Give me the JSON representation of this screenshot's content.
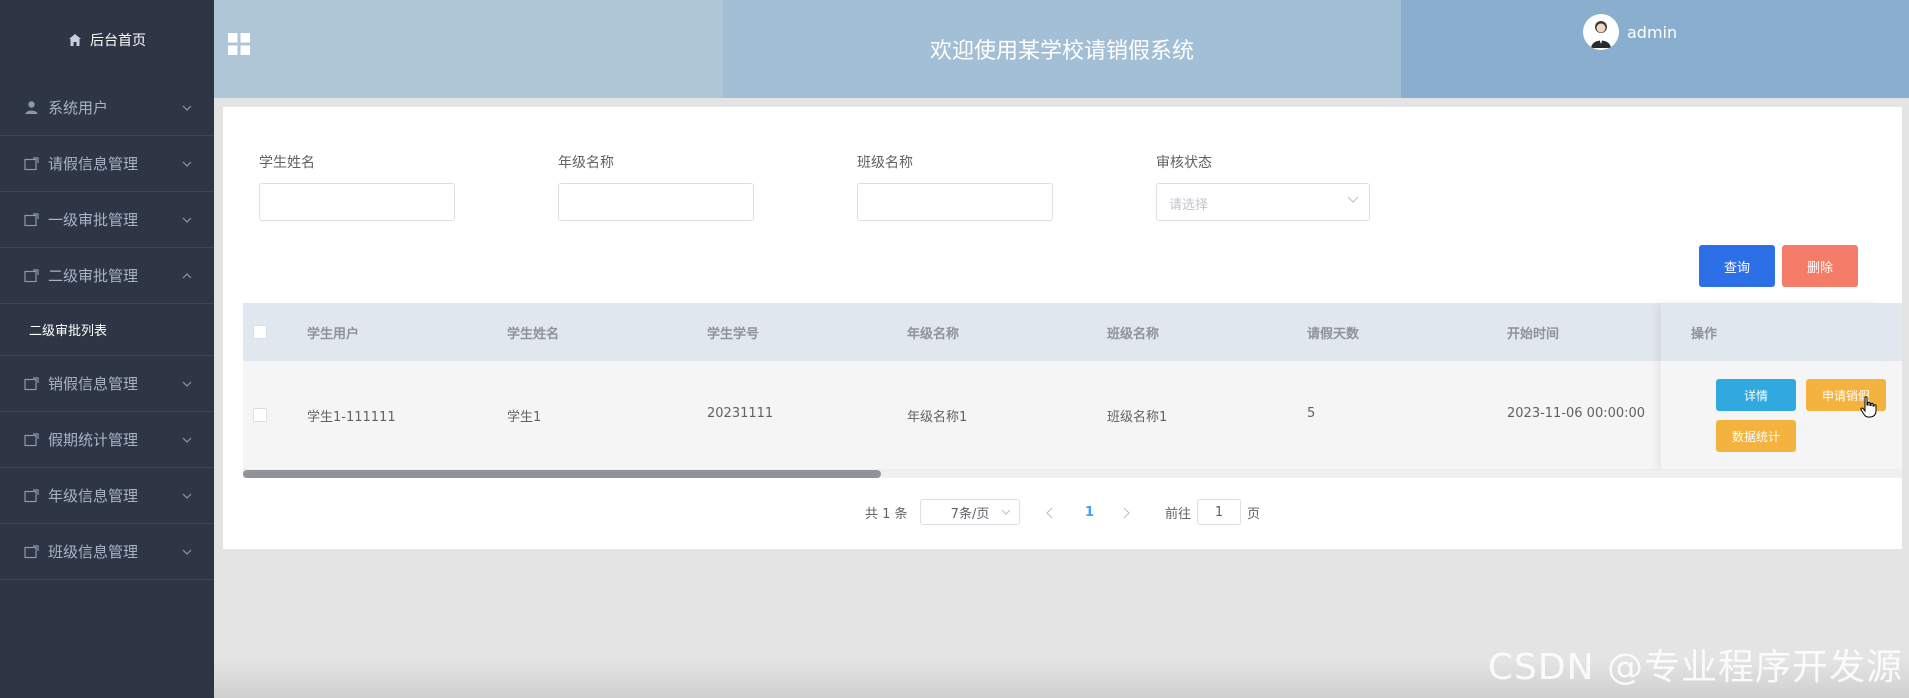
{
  "sidebar": {
    "home_label": "后台首页",
    "menus": [
      {
        "label": "系统用户",
        "icon": "user-icon"
      },
      {
        "label": "请假信息管理",
        "icon": "folder-icon"
      },
      {
        "label": "一级审批管理",
        "icon": "folder-icon"
      },
      {
        "label": "二级审批管理",
        "icon": "folder-icon",
        "expanded": true
      },
      {
        "label": "销假信息管理",
        "icon": "folder-icon"
      },
      {
        "label": "假期统计管理",
        "icon": "folder-icon"
      },
      {
        "label": "年级信息管理",
        "icon": "folder-icon"
      },
      {
        "label": "班级信息管理",
        "icon": "folder-icon"
      }
    ],
    "submenu_item": "二级审批列表"
  },
  "header": {
    "title": "欢迎使用某学校请销假系统",
    "username": "admin"
  },
  "filters": {
    "student_name_label": "学生姓名",
    "grade_name_label": "年级名称",
    "class_name_label": "班级名称",
    "status_label": "审核状态",
    "status_placeholder": "请选择"
  },
  "buttons": {
    "query": "查询",
    "delete": "删除"
  },
  "table": {
    "columns": [
      "学生用户",
      "学生姓名",
      "学生学号",
      "年级名称",
      "班级名称",
      "请假天数",
      "开始时间",
      "操作"
    ],
    "rows": [
      {
        "user": "学生1-111111",
        "name": "学生1",
        "student_no": "20231111",
        "grade": "年级名称1",
        "class_name": "班级名称1",
        "days": "5",
        "start_time": "2023-11-06 00:00:00",
        "actions": {
          "detail": "详情",
          "apply_cancel": "申请销假",
          "stats": "数据统计"
        }
      }
    ]
  },
  "pagination": {
    "total": "共 1 条",
    "page_size": "7条/页",
    "current_page": "1",
    "goto_label": "前往",
    "goto_value": "1",
    "page_suffix": "页"
  },
  "watermark": "CSDN @专业程序开发源",
  "colors": {
    "sidebar_bg": "#2e3545",
    "query_btn": "#2d6fe6",
    "delete_btn": "#f67c6a",
    "detail_btn": "#2fa9e0",
    "warning_btn": "#f4b23e"
  }
}
